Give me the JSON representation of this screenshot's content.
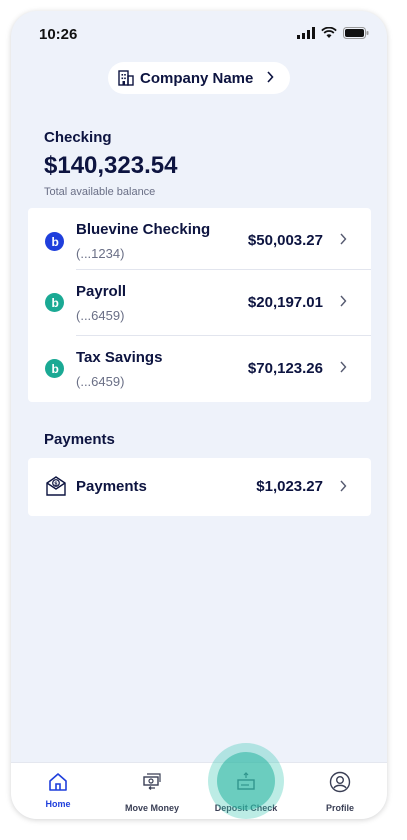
{
  "status": {
    "time": "10:26"
  },
  "company": {
    "name": "Company Name"
  },
  "checking": {
    "heading": "Checking",
    "balance": "$140,323.54",
    "balance_label": "Total available balance",
    "accounts": [
      {
        "name": "Bluevine Checking",
        "number": "(...1234)",
        "amount": "$50,003.27",
        "logo_color": "#1f3fdc"
      },
      {
        "name": "Payroll",
        "number": "(...6459)",
        "amount": "$20,197.01",
        "logo_color": "#1aa994"
      },
      {
        "name": "Tax Savings",
        "number": "(...6459)",
        "amount": "$70,123.26",
        "logo_color": "#1aa994"
      }
    ]
  },
  "payments": {
    "heading": "Payments",
    "row": {
      "label": "Payments",
      "amount": "$1,023.27"
    }
  },
  "tabbar": {
    "tabs": [
      {
        "label": "Home",
        "icon": "home-icon",
        "active": true
      },
      {
        "label": "Move Money",
        "icon": "move-money-icon",
        "active": false
      },
      {
        "label": "Deposit Check",
        "icon": "deposit-check-icon",
        "active": false
      },
      {
        "label": "Profile",
        "icon": "profile-icon",
        "active": false
      }
    ]
  },
  "colors": {
    "navy": "#0d1440",
    "active_tab": "#1f3fdc",
    "background": "#eef2fa"
  }
}
